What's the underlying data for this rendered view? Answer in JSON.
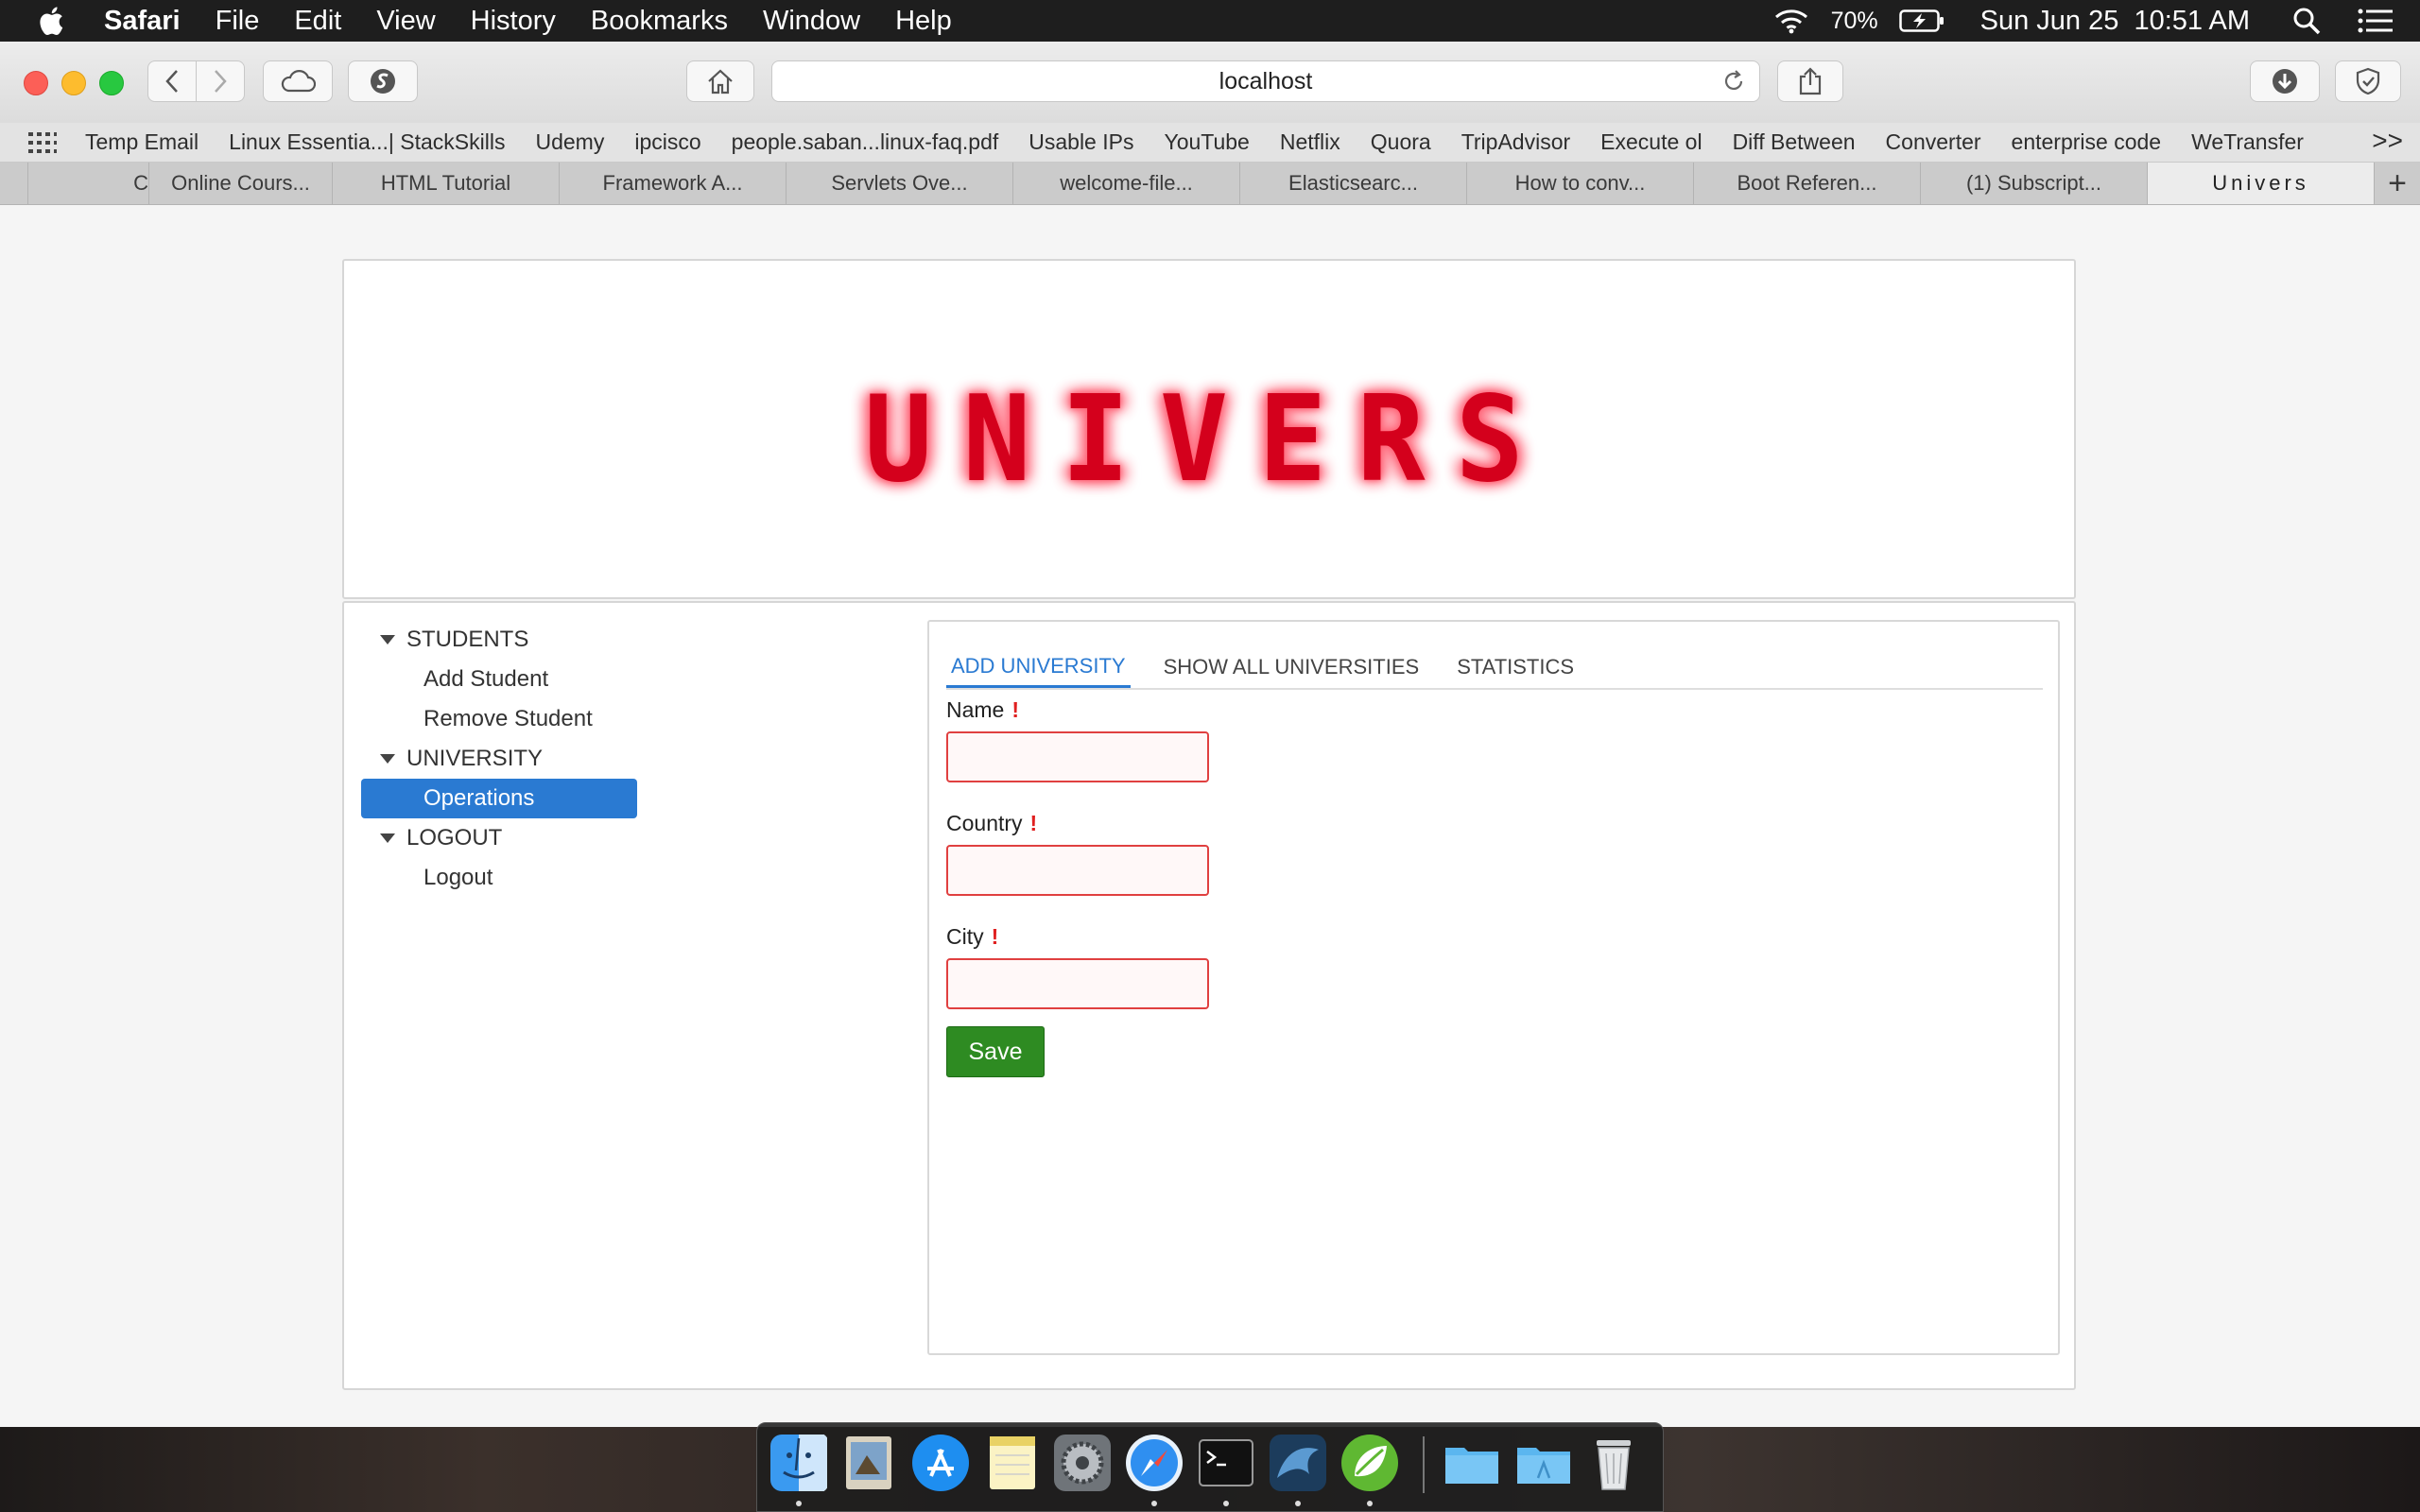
{
  "menubar": {
    "app_name": "Safari",
    "items": [
      "File",
      "Edit",
      "View",
      "History",
      "Bookmarks",
      "Window",
      "Help"
    ],
    "battery": "70%",
    "datetime": "Sun Jun 25  10:51 AM"
  },
  "toolbar": {
    "url": "localhost"
  },
  "bookmarks": {
    "items": [
      "Temp Email",
      "Linux Essentia...| StackSkills",
      "Udemy",
      "ipcisco",
      "people.saban...linux-faq.pdf",
      "Usable IPs",
      "YouTube",
      "Netflix",
      "Quora",
      "TripAdvisor",
      "Execute ol",
      "Diff Between",
      "Converter",
      "enterprise code",
      "WeTransfer"
    ],
    "more": ">>"
  },
  "tabs": {
    "items": [
      "",
      "C",
      "Online Cours...",
      "HTML Tutorial",
      "Framework A...",
      "Servlets Ove...",
      "welcome-file...",
      "Elasticsearc...",
      "How to conv...",
      "Boot Referen...",
      "(1) Subscript...",
      "Univers"
    ],
    "new_tab": "+"
  },
  "header": {
    "logo_text": "UNIVERS"
  },
  "sidebar": {
    "groups": [
      {
        "label": "STUDENTS",
        "children": [
          "Add Student",
          "Remove Student"
        ]
      },
      {
        "label": "UNIVERSITY",
        "children": [
          "Operations"
        ]
      },
      {
        "label": "LOGOUT",
        "children": [
          "Logout"
        ]
      }
    ]
  },
  "content": {
    "tabs": [
      "ADD UNIVERSITY",
      "SHOW ALL UNIVERSITIES",
      "STATISTICS"
    ],
    "active_tab": "ADD UNIVERSITY",
    "form": {
      "name_label": "Name",
      "country_label": "Country",
      "city_label": "City",
      "required_mark": "!",
      "name_value": "",
      "country_value": "",
      "city_value": "",
      "save_label": "Save"
    }
  },
  "colors": {
    "accent": "#2a7ad2",
    "save_button": "#2e8b22",
    "error_border": "#e04040",
    "logo_red": "#d4001c"
  },
  "dock": {
    "icons": [
      "finder-icon",
      "preview-icon",
      "app-store-icon",
      "notes-icon",
      "system-preferences-icon",
      "safari-icon",
      "terminal-icon",
      "mysql-workbench-icon",
      "spring-tool-suite-icon",
      "folder-icon",
      "applications-folder-icon",
      "trash-icon"
    ]
  }
}
